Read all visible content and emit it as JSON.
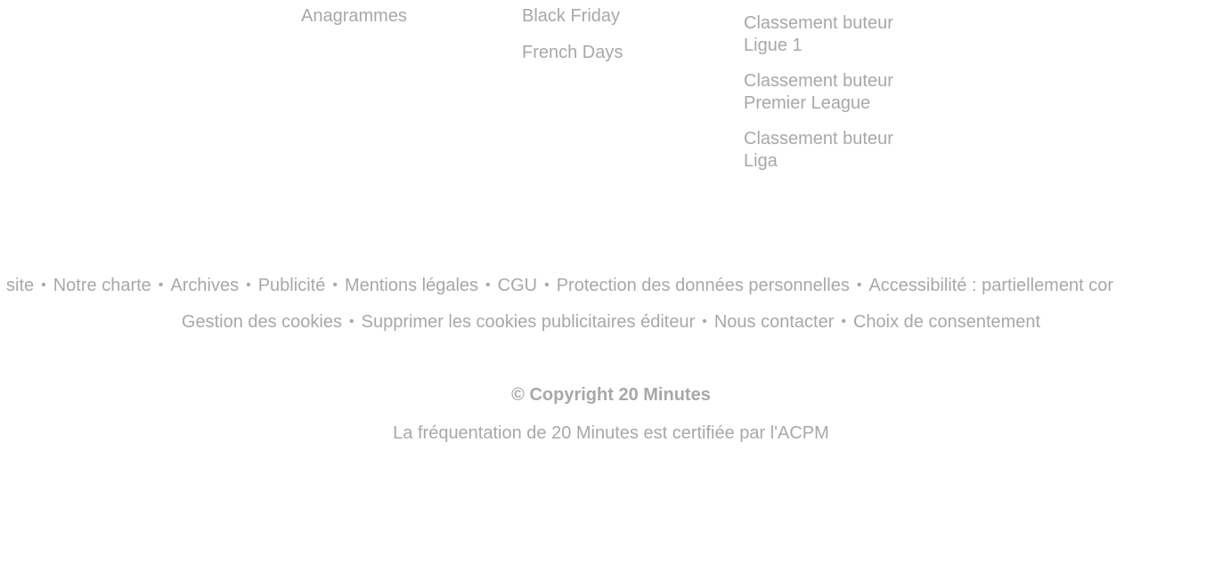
{
  "footer_columns": {
    "col1": [
      "Anagrammes"
    ],
    "col2": [
      "Black Friday",
      "French Days"
    ],
    "col3": [
      "Classement buteur\nLigue 1",
      "Classement buteur\nPremier League",
      "Classement buteur\nLiga"
    ]
  },
  "legal_links_row1": [
    "site",
    "Notre charte",
    "Archives",
    "Publicité",
    "Mentions légales",
    "CGU",
    "Protection des données personnelles",
    "Accessibilité : partiellement cor"
  ],
  "legal_links_row2": [
    "Gestion des cookies",
    "Supprimer les cookies publicitaires éditeur",
    "Nous contacter",
    "Choix de consentement"
  ],
  "separator": "•",
  "copyright": "© Copyright 20 Minutes",
  "acpm_text": "La fréquentation de 20 Minutes est certifiée par l'ACPM",
  "colors": {
    "link": "#a8a8a8",
    "background": "#ffffff"
  }
}
